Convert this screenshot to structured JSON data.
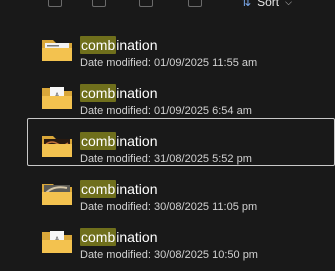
{
  "toolbar": {
    "icons": [
      "copy-icon",
      "paste-icon",
      "share-icon",
      "delete-icon"
    ],
    "sort_label": "Sort",
    "sort_icon": "sort-icon",
    "chevron_icon": "chevron-down-icon"
  },
  "search": {
    "highlight_color": "#6f6f1c"
  },
  "items": [
    {
      "name_match": "comb",
      "name_rest": "ination",
      "meta_label": "Date modified:",
      "meta_value": "01/09/2025 11:55 am",
      "folder_thumb": "folder-with-documents",
      "selected": false
    },
    {
      "name_match": "comb",
      "name_rest": "ination",
      "meta_label": "Date modified:",
      "meta_value": "01/09/2025 6:54 am",
      "folder_thumb": "folder-with-page",
      "selected": false
    },
    {
      "name_match": "comb",
      "name_rest": "ination",
      "meta_label": "Date modified:",
      "meta_value": "31/08/2025 5:52 pm",
      "folder_thumb": "folder-with-dark-image",
      "selected": true
    },
    {
      "name_match": "comb",
      "name_rest": "ination",
      "meta_label": "Date modified:",
      "meta_value": "30/08/2025 11:05 pm",
      "folder_thumb": "folder-with-photo",
      "selected": false
    },
    {
      "name_match": "comb",
      "name_rest": "ination",
      "meta_label": "Date modified:",
      "meta_value": "30/08/2025 10:50 pm",
      "folder_thumb": "folder-with-page",
      "selected": false
    }
  ]
}
